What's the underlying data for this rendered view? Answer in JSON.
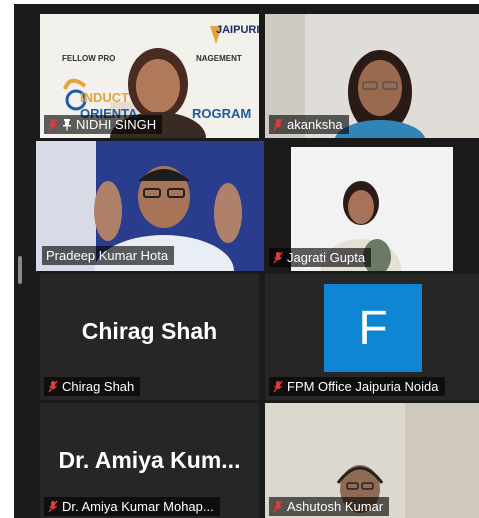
{
  "participants": [
    {
      "name": "NIDHI SINGH",
      "muted": true,
      "pinned": true
    },
    {
      "name": "akanksha",
      "muted": true
    },
    {
      "name": "Pradeep Kumar Hota",
      "muted": false,
      "active_speaker": true
    },
    {
      "name": "Jagrati Gupta",
      "muted": true
    },
    {
      "name": "Chirag Shah",
      "muted": true,
      "video_off": true,
      "display_name": "Chirag Shah"
    },
    {
      "name": "FPM Office Jaipuria Noida",
      "muted": true,
      "video_off": true,
      "avatar_letter": "F"
    },
    {
      "name": "Dr. Amiya Kumar Mohap...",
      "muted": true,
      "video_off": true,
      "display_name": "Dr. Amiya Kum..."
    },
    {
      "name": "Ashutosh Kumar",
      "muted": true
    }
  ],
  "banner": {
    "brand": "JAIPURIA",
    "line1": "FELLOW PRO",
    "line1b": "NAGEMENT",
    "induct": "INDUCT",
    "orient": "ORIENTA",
    "program": "ROGRAM"
  },
  "colors": {
    "active_border": "#c8db3e",
    "muted_icon": "#e03b3b",
    "avatar_bg": "#0e86d4"
  }
}
